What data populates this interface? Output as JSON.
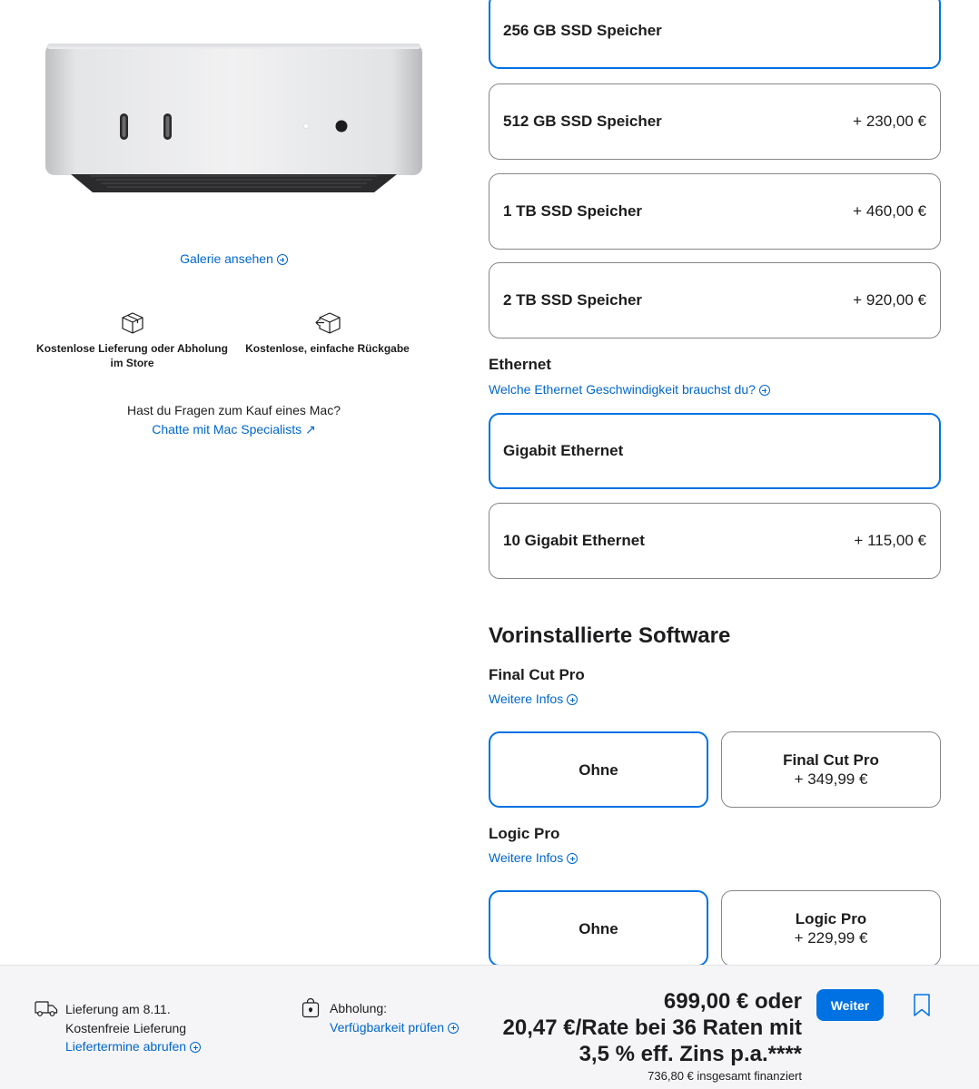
{
  "gallery": {
    "link_label": "Galerie ansehen"
  },
  "perks": [
    {
      "icon": "box-icon",
      "label": "Kostenlose Lieferung oder Abholung im Store"
    },
    {
      "icon": "return-box-icon",
      "label": "Kostenlose, einfache Rückgabe"
    }
  ],
  "help": {
    "question": "Hast du Fragen zum Kauf eines Mac?",
    "chat_link": "Chatte mit Mac Specialists ↗"
  },
  "storage": {
    "options": [
      {
        "label": "256 GB SSD Speicher",
        "price": "",
        "selected": true
      },
      {
        "label": "512 GB SSD Speicher",
        "price": "+ 230,00 €"
      },
      {
        "label": "1 TB SSD Speicher",
        "price": "+ 460,00 €"
      },
      {
        "label": "2 TB SSD Speicher",
        "price": "+ 920,00 €"
      }
    ]
  },
  "ethernet": {
    "heading": "Ethernet",
    "help_link": "Welche Ethernet Geschwindigkeit brauchst du?",
    "options": [
      {
        "label": "Gigabit Ethernet",
        "price": "",
        "selected": true
      },
      {
        "label": "10 Gigabit Ethernet",
        "price": "+ 115,00 €"
      }
    ]
  },
  "software": {
    "title": "Vorinstallierte Software",
    "final_cut": {
      "heading": "Final Cut Pro",
      "info_link": "Weitere Infos",
      "none_label": "Ohne",
      "option_name": "Final Cut Pro",
      "option_price": "+ 349,99 €"
    },
    "logic": {
      "heading": "Logic Pro",
      "info_link": "Weitere Infos",
      "none_label": "Ohne",
      "option_name": "Logic Pro",
      "option_price": "+ 229,99 €"
    }
  },
  "bottom_bar": {
    "delivery_title": "Lieferung am 8.11.",
    "delivery_sub": "Kostenfreie Lieferung",
    "delivery_link": "Liefertermine abrufen",
    "pickup_title": "Abholung:",
    "pickup_link": "Verfügbarkeit prüfen",
    "price_line1": "699,00 € oder",
    "price_line2": "20,47 €/Rate bei 36 Raten mit",
    "price_line3": "3,5 % eff. Zins p.a.****",
    "financed_total": "736,80 € insgesamt finanziert",
    "continue_label": "Weiter"
  },
  "colors": {
    "accent": "#0071e3",
    "link": "#0066cc",
    "bar_bg": "#f5f5f7",
    "border": "#86868b"
  }
}
